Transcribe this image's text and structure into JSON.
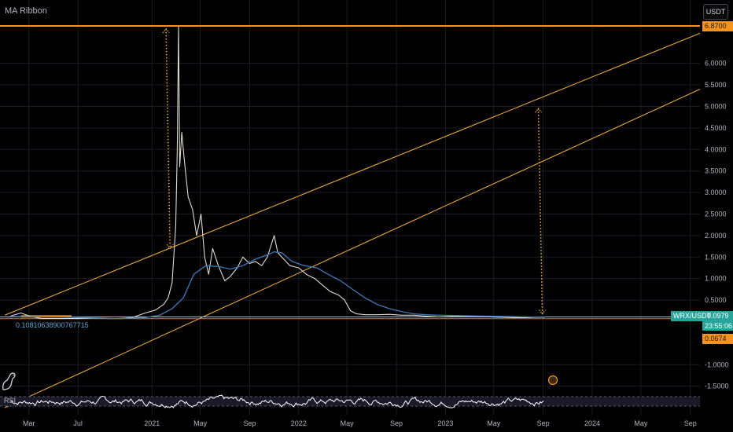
{
  "indicator_title": "MA Ribbon",
  "currency": "USDT",
  "symbol": "WRX/USDT",
  "last_price": "0.0979",
  "countdown": "23:55:06",
  "lower_line_price": "0.0674",
  "top_line_price": "6.8700",
  "hline_label": "0.10810638900767715",
  "rsi_label": "RSI",
  "colors": {
    "background": "#000000",
    "price": "#e0dbd0",
    "ma": "#3f78b5",
    "trend": "#f7b53a",
    "top_line": "#f7931a",
    "hline": "#9fc5e8",
    "rsi": "#ffffff",
    "grid": "#1c1c24",
    "accent": "#26a69a"
  },
  "chart_data": {
    "type": "line",
    "y_scale": "linear",
    "ylim": [
      -1.6,
      6.95
    ],
    "y_ticks": [
      -1.5,
      -1.0,
      0.5,
      1.0,
      1.5,
      2.0,
      2.5,
      3.0,
      3.5,
      4.0,
      4.5,
      5.0,
      5.5,
      6.0
    ],
    "y_tick_labels": [
      "-1.5000",
      "-1.0000",
      "0.5000",
      "1.0000",
      "1.5000",
      "2.0000",
      "2.5000",
      "3.0000",
      "3.5000",
      "4.0000",
      "4.5000",
      "5.0000",
      "5.5000",
      "6.0000"
    ],
    "x_ticks": [
      "2020-03-01",
      "2020-07-01",
      "2021-01-01",
      "2021-05-01",
      "2021-09-01",
      "2022-01-01",
      "2022-05-01",
      "2022-09-01",
      "2023-01-01",
      "2023-05-01",
      "2023-09-01",
      "2024-01-01",
      "2024-05-01",
      "2024-09-01"
    ],
    "x_tick_labels": [
      "Mar",
      "Jul",
      "2021",
      "May",
      "Sep",
      "2022",
      "May",
      "Sep",
      "2023",
      "May",
      "Sep",
      "2024",
      "May",
      "Sep"
    ],
    "xlim": [
      "2019-12-20",
      "2024-09-25"
    ],
    "series": [
      {
        "role": "price",
        "points": [
          [
            "2020-01-15",
            0.13
          ],
          [
            "2020-02-10",
            0.2
          ],
          [
            "2020-03-05",
            0.12
          ],
          [
            "2020-04-01",
            0.07
          ],
          [
            "2020-05-01",
            0.07
          ],
          [
            "2020-06-01",
            0.07
          ],
          [
            "2020-07-01",
            0.07
          ],
          [
            "2020-08-15",
            0.08
          ],
          [
            "2020-09-15",
            0.07
          ],
          [
            "2020-10-15",
            0.07
          ],
          [
            "2020-11-15",
            0.1
          ],
          [
            "2020-12-15",
            0.2
          ],
          [
            "2021-01-10",
            0.27
          ],
          [
            "2021-01-30",
            0.4
          ],
          [
            "2021-02-10",
            0.55
          ],
          [
            "2021-02-20",
            0.9
          ],
          [
            "2021-03-01",
            2.2
          ],
          [
            "2021-03-05",
            4.0
          ],
          [
            "2021-03-08",
            6.85
          ],
          [
            "2021-03-11",
            3.6
          ],
          [
            "2021-03-16",
            4.4
          ],
          [
            "2021-03-22",
            3.8
          ],
          [
            "2021-04-01",
            2.9
          ],
          [
            "2021-04-12",
            2.6
          ],
          [
            "2021-04-22",
            2.0
          ],
          [
            "2021-05-03",
            2.5
          ],
          [
            "2021-05-12",
            1.5
          ],
          [
            "2021-05-22",
            1.1
          ],
          [
            "2021-06-01",
            1.7
          ],
          [
            "2021-06-15",
            1.3
          ],
          [
            "2021-07-01",
            0.95
          ],
          [
            "2021-07-15",
            1.05
          ],
          [
            "2021-08-01",
            1.25
          ],
          [
            "2021-08-15",
            1.5
          ],
          [
            "2021-09-01",
            1.35
          ],
          [
            "2021-09-15",
            1.4
          ],
          [
            "2021-10-01",
            1.3
          ],
          [
            "2021-10-15",
            1.5
          ],
          [
            "2021-11-01",
            2.0
          ],
          [
            "2021-11-10",
            1.6
          ],
          [
            "2021-11-25",
            1.45
          ],
          [
            "2021-12-10",
            1.3
          ],
          [
            "2022-01-01",
            1.25
          ],
          [
            "2022-01-20",
            1.1
          ],
          [
            "2022-02-10",
            1.0
          ],
          [
            "2022-03-01",
            0.85
          ],
          [
            "2022-03-20",
            0.7
          ],
          [
            "2022-04-10",
            0.62
          ],
          [
            "2022-04-25",
            0.5
          ],
          [
            "2022-05-10",
            0.25
          ],
          [
            "2022-05-25",
            0.18
          ],
          [
            "2022-06-15",
            0.16
          ],
          [
            "2022-07-15",
            0.16
          ],
          [
            "2022-08-15",
            0.17
          ],
          [
            "2022-09-15",
            0.15
          ],
          [
            "2022-10-15",
            0.15
          ],
          [
            "2022-11-10",
            0.13
          ],
          [
            "2022-12-15",
            0.11
          ],
          [
            "2023-01-20",
            0.12
          ],
          [
            "2023-02-20",
            0.13
          ],
          [
            "2023-03-20",
            0.12
          ],
          [
            "2023-04-20",
            0.11
          ],
          [
            "2023-05-20",
            0.1
          ],
          [
            "2023-06-20",
            0.09
          ],
          [
            "2023-07-20",
            0.09
          ],
          [
            "2023-08-20",
            0.1
          ],
          [
            "2023-09-05",
            0.0979
          ]
        ]
      },
      {
        "role": "moving-average",
        "points": [
          [
            "2020-01-15",
            0.12
          ],
          [
            "2020-06-01",
            0.1
          ],
          [
            "2020-10-01",
            0.07
          ],
          [
            "2020-12-15",
            0.09
          ],
          [
            "2021-01-20",
            0.15
          ],
          [
            "2021-02-20",
            0.3
          ],
          [
            "2021-03-20",
            0.55
          ],
          [
            "2021-04-15",
            1.1
          ],
          [
            "2021-05-15",
            1.3
          ],
          [
            "2021-06-15",
            1.28
          ],
          [
            "2021-07-15",
            1.22
          ],
          [
            "2021-08-15",
            1.3
          ],
          [
            "2021-09-15",
            1.45
          ],
          [
            "2021-10-15",
            1.55
          ],
          [
            "2021-11-01",
            1.62
          ],
          [
            "2021-11-20",
            1.6
          ],
          [
            "2021-12-15",
            1.4
          ],
          [
            "2022-01-15",
            1.3
          ],
          [
            "2022-02-15",
            1.25
          ],
          [
            "2022-03-15",
            1.1
          ],
          [
            "2022-04-15",
            0.95
          ],
          [
            "2022-05-15",
            0.75
          ],
          [
            "2022-06-15",
            0.55
          ],
          [
            "2022-07-15",
            0.4
          ],
          [
            "2022-08-15",
            0.3
          ],
          [
            "2022-09-15",
            0.23
          ],
          [
            "2022-10-15",
            0.18
          ],
          [
            "2022-11-15",
            0.16
          ],
          [
            "2022-12-15",
            0.15
          ],
          [
            "2023-02-01",
            0.14
          ],
          [
            "2023-04-01",
            0.13
          ],
          [
            "2023-06-01",
            0.12
          ],
          [
            "2023-09-05",
            0.1
          ]
        ]
      }
    ],
    "trend_lines": [
      {
        "from": [
          "2020-01-01",
          0.15
        ],
        "to": [
          "2024-09-25",
          6.7
        ]
      },
      {
        "from": [
          "2020-01-01",
          -2.0
        ],
        "to": [
          "2024-09-25",
          5.4
        ]
      }
    ],
    "horizontal_lines": [
      {
        "role": "top",
        "y": 6.87
      },
      {
        "role": "level",
        "y": 0.10810638900767715
      },
      {
        "role": "lower",
        "y": 0.0674
      }
    ],
    "arrows": [
      {
        "from": [
          "2021-02-05",
          6.8
        ],
        "to": [
          "2021-02-15",
          1.7
        ]
      },
      {
        "from": [
          "2023-08-20",
          4.95
        ],
        "to": [
          "2023-08-30",
          0.18
        ]
      }
    ],
    "highlight_band": {
      "from": "2020-02-10",
      "to": "2020-06-15",
      "y": 0.12
    },
    "rsi": {
      "ylim": [
        0,
        100
      ],
      "upper": 70,
      "lower": 30,
      "end_date": "2023-09-05"
    }
  }
}
